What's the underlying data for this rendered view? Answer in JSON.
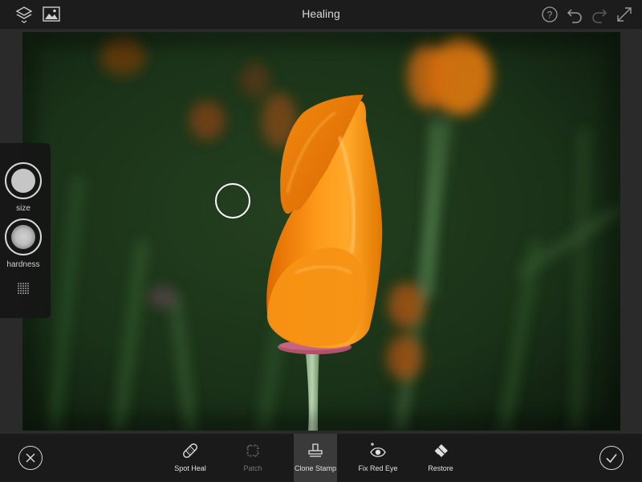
{
  "header": {
    "title": "Healing",
    "icons": [
      "layers-icon",
      "image-icon",
      "help-icon",
      "undo-icon",
      "redo-icon",
      "expand-icon"
    ]
  },
  "side_panel": {
    "size_label": "size",
    "hardness_label": "hardness"
  },
  "toolbar": {
    "tools": [
      {
        "label": "Spot Heal",
        "icon": "bandage-icon",
        "state": "enabled"
      },
      {
        "label": "Patch",
        "icon": "patch-icon",
        "state": "disabled"
      },
      {
        "label": "Clone Stamp",
        "icon": "stamp-icon",
        "state": "selected"
      },
      {
        "label": "Fix Red Eye",
        "icon": "red-eye-icon",
        "state": "enabled"
      },
      {
        "label": "Restore",
        "icon": "eraser-icon",
        "state": "enabled"
      }
    ],
    "cancel_icon": "close-icon",
    "confirm_icon": "check-icon"
  },
  "colors": {
    "topbar_bg": "#1c1c1c",
    "bottombar_bg": "#1a1a1a",
    "active_tool_bg": "#3a3a3a",
    "flower_orange": "#f58a0c",
    "background_green": "#1e3a1c"
  }
}
